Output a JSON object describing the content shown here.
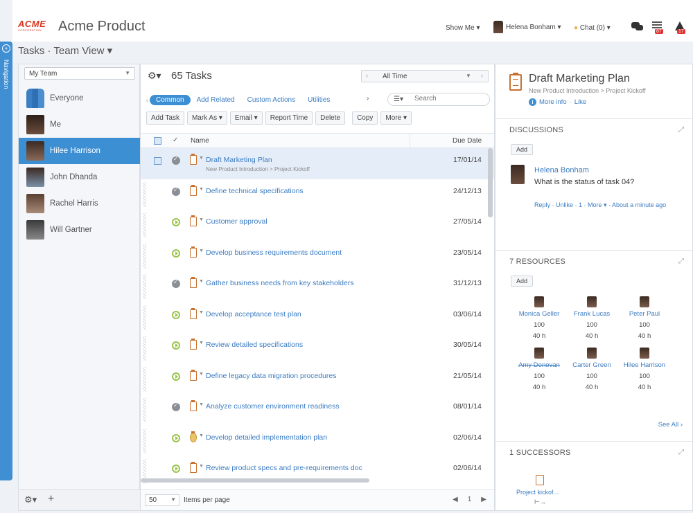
{
  "header": {
    "logo_text": "ACME",
    "logo_sub": "CORPORATION",
    "app_title": "Acme Product",
    "show_me": "Show Me ▾",
    "user_name": "Helena Bonham ▾",
    "chat": "Chat (0) ▾",
    "feed_badge": "87",
    "alert_badge": "17"
  },
  "nav": {
    "label": "Navigation"
  },
  "view_title": "Tasks · Team View ▾",
  "team": {
    "selector": "My Team",
    "members": [
      {
        "name": "Everyone"
      },
      {
        "name": "Me"
      },
      {
        "name": "Hilee Harrison"
      },
      {
        "name": "John Dhanda"
      },
      {
        "name": "Rachel Harris"
      },
      {
        "name": "Will Gartner"
      }
    ]
  },
  "tasks": {
    "count_title": "65 Tasks",
    "time_filter": "All Time",
    "tabs": [
      "Common",
      "Add Related",
      "Custom Actions",
      "Utilities"
    ],
    "search_placeholder": "Search",
    "toolbar": [
      "Add Task",
      "Mark As ▾",
      "Email ▾",
      "Report Time",
      "Delete",
      "Copy",
      "More ▾"
    ],
    "col_name": "Name",
    "col_due": "Due Date",
    "rows": [
      {
        "name": "Draft Marketing Plan",
        "sub": "New Product Introduction > Project Kickoff",
        "date": "17/01/14"
      },
      {
        "name": "Define technical specifications",
        "sub": "",
        "date": "24/12/13"
      },
      {
        "name": "Customer approval",
        "sub": "",
        "date": "27/05/14"
      },
      {
        "name": "Develop business requirements document",
        "sub": "",
        "date": "23/05/14"
      },
      {
        "name": "Gather business needs from key stakeholders",
        "sub": "",
        "date": "31/12/13"
      },
      {
        "name": "Develop acceptance test plan",
        "sub": "",
        "date": "03/06/14"
      },
      {
        "name": "Review detailed specifications",
        "sub": "",
        "date": "30/05/14"
      },
      {
        "name": "Define legacy data migration procedures",
        "sub": "",
        "date": "21/05/14"
      },
      {
        "name": "Analyze customer environment readiness",
        "sub": "",
        "date": "08/01/14"
      },
      {
        "name": "Develop detailed implementation plan",
        "sub": "",
        "date": "02/06/14"
      },
      {
        "name": "Review product specs and pre-requirements doc",
        "sub": "",
        "date": "02/06/14"
      }
    ],
    "per_page": "50",
    "per_page_label": "Items per page",
    "page": "1"
  },
  "detail": {
    "title": "Draft Marketing Plan",
    "crumb": "New Product Introduction > Project Kickoff",
    "more_info": "More info",
    "like": "Like",
    "discussions_h": "DISCUSSIONS",
    "add": "Add",
    "comment_author": "Helena Bonham",
    "comment_text": "What is the status of task 04?",
    "comment_actions": "Reply · Unlike · 1 · More ▾ · About a minute ago",
    "resources_h": "7 RESOURCES",
    "resources": [
      {
        "name": "Monica Geller",
        "pct": "100",
        "hrs": "40 h"
      },
      {
        "name": "Frank Lucas",
        "pct": "100",
        "hrs": "40 h"
      },
      {
        "name": "Peter Paul",
        "pct": "100",
        "hrs": "40 h"
      },
      {
        "name": "Amy Donovan",
        "pct": "100",
        "hrs": "40 h"
      },
      {
        "name": "Carter Green",
        "pct": "100",
        "hrs": "40 h"
      },
      {
        "name": "Hilee Harrison",
        "pct": "100",
        "hrs": "40 h"
      }
    ],
    "see_all": "See All ›",
    "successors_h": "1 SUCCESSORS",
    "successor": "Project kickof..."
  }
}
